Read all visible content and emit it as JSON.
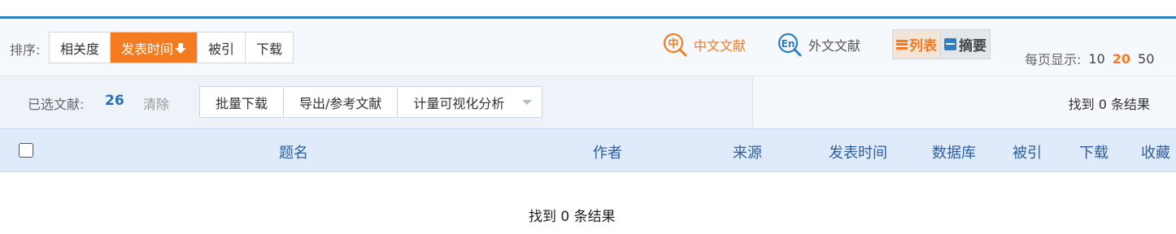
{
  "sort": {
    "label": "排序:",
    "options": [
      "相关度",
      "发表时间",
      "被引",
      "下载"
    ],
    "active": "发表时间"
  },
  "language": {
    "chinese": {
      "label": "中文文献",
      "icon": "zhong-icon"
    },
    "foreign": {
      "label": "外文文献",
      "icon": "en-icon"
    }
  },
  "view": {
    "list": "列表",
    "abstract": "摘要"
  },
  "per_page": {
    "label": "每页显示:",
    "options": [
      "10",
      "20",
      "50"
    ],
    "selected": "20"
  },
  "selection": {
    "label": "已选文献:",
    "count": "26",
    "clear": "清除",
    "actions": [
      "批量下载",
      "导出/参考文献",
      "计量可视化分析"
    ]
  },
  "result_summary": "找到 0 条结果",
  "table": {
    "columns": [
      "题名",
      "作者",
      "来源",
      "发表时间",
      "数据库",
      "被引",
      "下载",
      "收藏"
    ]
  },
  "empty_message": "找到 0 条结果",
  "colors": {
    "accent": "#f57b21",
    "primary": "#2b7fc2",
    "header_bg": "#dfeafa"
  }
}
